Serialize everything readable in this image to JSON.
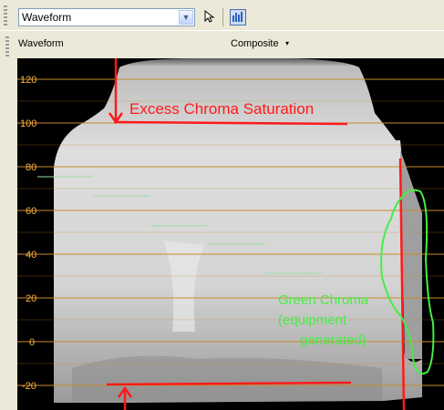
{
  "toolbar": {
    "scope_select_value": "Waveform",
    "dropdown_icon": "chevron-down-icon",
    "cursor_icon": "pointer-icon",
    "waveform_icon": "waveform-histogram-icon"
  },
  "panel": {
    "title": "Waveform",
    "mode_value": "Composite",
    "mode_caret": "▾"
  },
  "scope": {
    "y_ticks": [
      "120",
      "100",
      "80",
      "60",
      "40",
      "20",
      "0",
      "-20"
    ],
    "grid_color": "#c98a2e",
    "annotations": {
      "excess_chroma": "Excess Chroma Saturation",
      "green_line1": "Green Chroma",
      "green_line2": "(equipment",
      "green_line3": "generated)"
    }
  }
}
